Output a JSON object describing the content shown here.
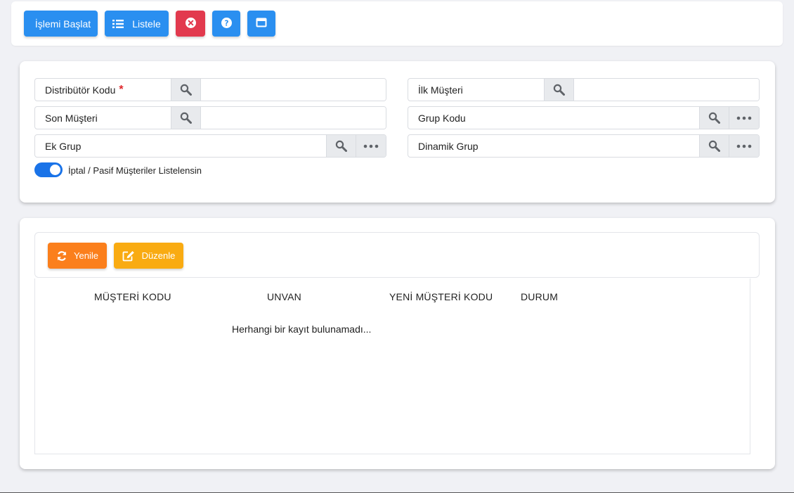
{
  "toolbar": {
    "start_label": "İşlemi Başlat",
    "list_label": "Listele",
    "cancel_icon": "close-circle-icon",
    "help_icon": "question-circle-icon",
    "window_icon": "window-icon",
    "colors": {
      "primary": "#2a8ff0",
      "danger": "#e23a4e"
    }
  },
  "filters": {
    "distributor_code": {
      "label": "Distribütör Kodu",
      "required_mark": "*",
      "value": ""
    },
    "first_customer": {
      "label": "İlk Müşteri",
      "value": ""
    },
    "last_customer": {
      "label": "Son Müşteri",
      "value": ""
    },
    "group_code": {
      "label": "Grup Kodu"
    },
    "extra_group": {
      "label": "Ek Grup"
    },
    "dynamic_group": {
      "label": "Dinamik Grup"
    },
    "toggle": {
      "label": "İptal / Pasif Müşteriler Listelensin",
      "checked": true
    }
  },
  "grid": {
    "refresh_label": "Yenile",
    "edit_label": "Düzenle",
    "columns": [
      "MÜŞTERİ KODU",
      "UNVAN",
      "YENİ MÜŞTERİ KODU",
      "DURUM"
    ],
    "empty_message": "Herhangi bir kayıt bulunamadı...",
    "colors": {
      "refresh": "#fb7f1c",
      "edit": "#f9ab12"
    }
  }
}
